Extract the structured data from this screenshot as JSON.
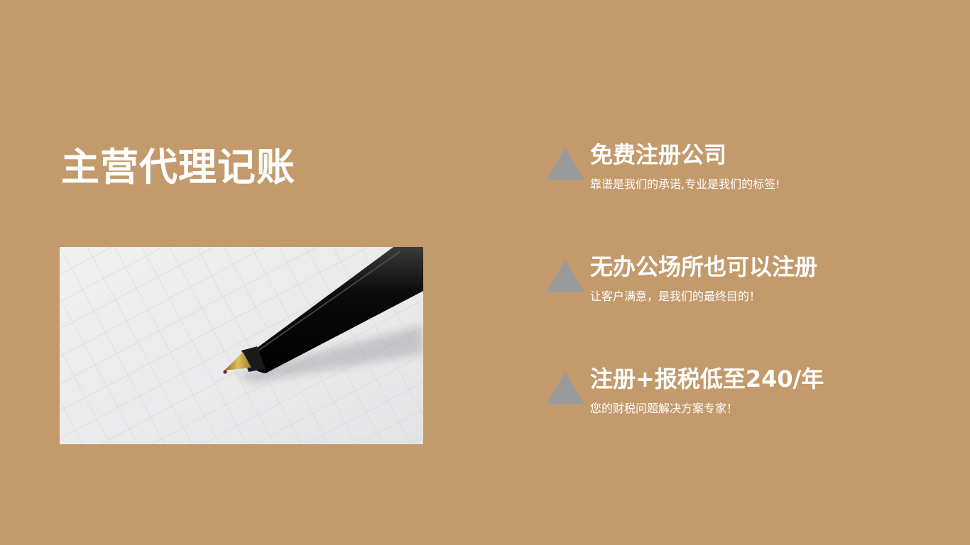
{
  "theme": {
    "background": "#c39a6b",
    "text_color": "#ffffff",
    "triangle_color": "#9a9a9a"
  },
  "slide": {
    "title": "主营代理记账",
    "image": {
      "icon": "pen-on-grid-paper-photo"
    },
    "features": [
      {
        "title": "免费注册公司",
        "description": "靠谱是我们的承诺,专业是我们的标签!",
        "icon": "triangle-bullet-icon"
      },
      {
        "title": "无办公场所也可以注册",
        "description": "让客户满意，是我们的最终目的！",
        "icon": "triangle-bullet-icon"
      },
      {
        "title": "注册+报税低至240/年",
        "description": "您的财税问题解决方案专家！",
        "icon": "triangle-bullet-icon"
      }
    ]
  }
}
